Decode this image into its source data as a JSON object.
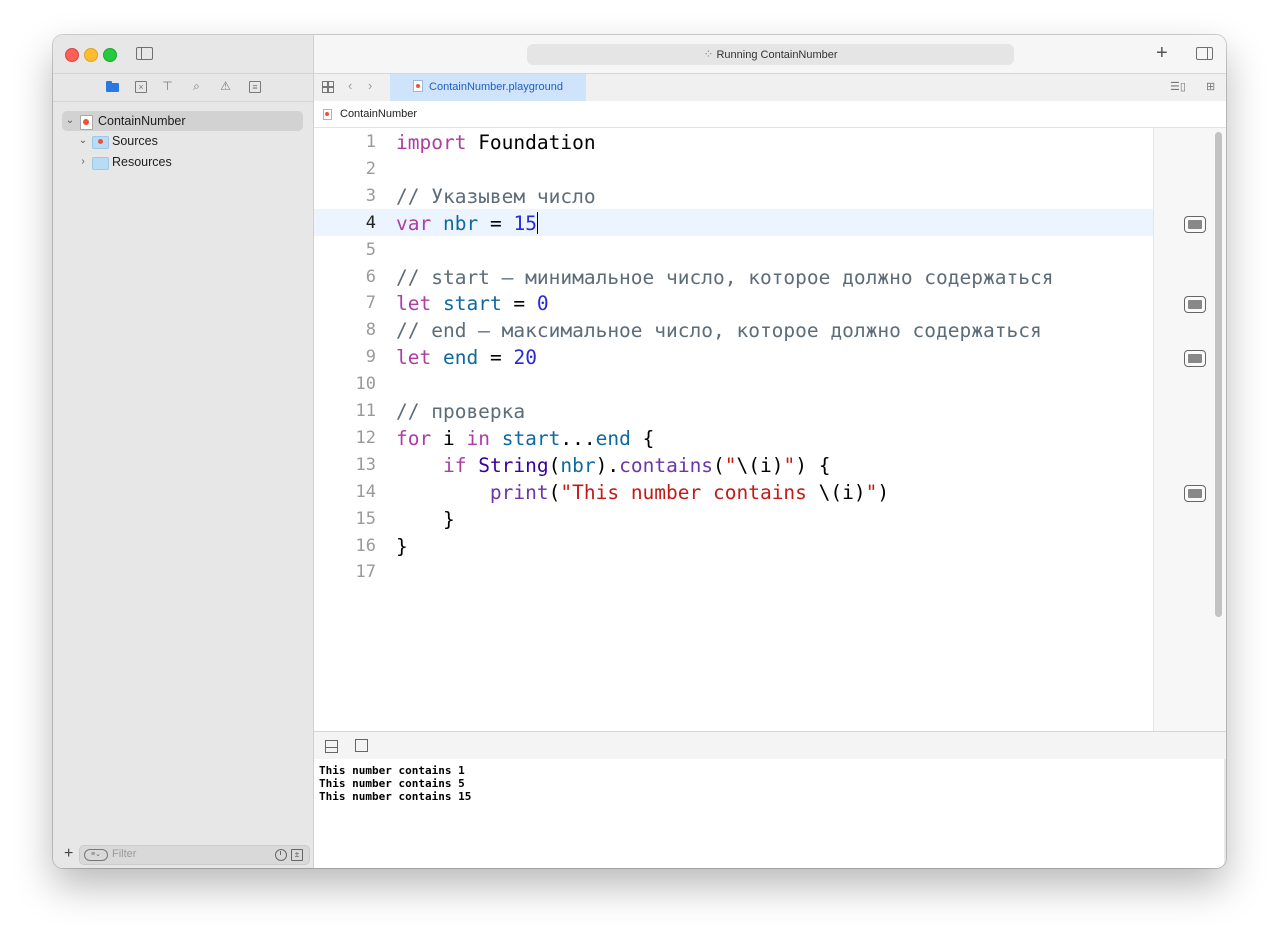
{
  "window": {
    "activity_status": "Running ContainNumber",
    "tab_title": "ContainNumber.playground",
    "jump_bar": "ContainNumber"
  },
  "sidebar": {
    "tree": [
      {
        "label": "ContainNumber",
        "kind": "playground",
        "expanded": true,
        "selected": true
      },
      {
        "label": "Sources",
        "kind": "folder",
        "expanded": true
      },
      {
        "label": "Resources",
        "kind": "folder",
        "expanded": false
      }
    ],
    "filter_placeholder": "Filter"
  },
  "editor": {
    "current_line": 4,
    "line_numbers": [
      "1",
      "2",
      "3",
      "4",
      "5",
      "6",
      "7",
      "8",
      "9",
      "10",
      "11",
      "12",
      "13",
      "14",
      "15",
      "16",
      "17"
    ],
    "lines": [
      [
        {
          "t": "kw",
          "v": "import"
        },
        {
          "t": "pl",
          "v": " Foundation"
        }
      ],
      [],
      [
        {
          "t": "cm",
          "v": "// Указывем число"
        }
      ],
      [
        {
          "t": "kw",
          "v": "var"
        },
        {
          "t": "pl",
          "v": " "
        },
        {
          "t": "vr",
          "v": "nbr"
        },
        {
          "t": "pl",
          "v": " = "
        },
        {
          "t": "nm",
          "v": "15"
        }
      ],
      [],
      [
        {
          "t": "cm",
          "v": "// start – минимальное число, которое должно содержаться"
        }
      ],
      [
        {
          "t": "kw",
          "v": "let"
        },
        {
          "t": "pl",
          "v": " "
        },
        {
          "t": "vr",
          "v": "start"
        },
        {
          "t": "pl",
          "v": " = "
        },
        {
          "t": "nm",
          "v": "0"
        }
      ],
      [
        {
          "t": "cm",
          "v": "// end – максимальное число, которое должно содержаться"
        }
      ],
      [
        {
          "t": "kw",
          "v": "let"
        },
        {
          "t": "pl",
          "v": " "
        },
        {
          "t": "vr",
          "v": "end"
        },
        {
          "t": "pl",
          "v": " = "
        },
        {
          "t": "nm",
          "v": "20"
        }
      ],
      [],
      [
        {
          "t": "cm",
          "v": "// проверка"
        }
      ],
      [
        {
          "t": "kw",
          "v": "for"
        },
        {
          "t": "pl",
          "v": " i "
        },
        {
          "t": "kw",
          "v": "in"
        },
        {
          "t": "pl",
          "v": " "
        },
        {
          "t": "vr",
          "v": "start"
        },
        {
          "t": "pl",
          "v": "..."
        },
        {
          "t": "vr",
          "v": "end"
        },
        {
          "t": "pl",
          "v": " {"
        }
      ],
      [
        {
          "t": "pl",
          "v": "    "
        },
        {
          "t": "kw",
          "v": "if"
        },
        {
          "t": "pl",
          "v": " "
        },
        {
          "t": "ty",
          "v": "String"
        },
        {
          "t": "pl",
          "v": "("
        },
        {
          "t": "vr",
          "v": "nbr"
        },
        {
          "t": "pl",
          "v": ")."
        },
        {
          "t": "fn",
          "v": "contains"
        },
        {
          "t": "pl",
          "v": "("
        },
        {
          "t": "str",
          "v": "\""
        },
        {
          "t": "pl",
          "v": "\\(i)"
        },
        {
          "t": "str",
          "v": "\""
        },
        {
          "t": "pl",
          "v": ") {"
        }
      ],
      [
        {
          "t": "pl",
          "v": "        "
        },
        {
          "t": "fn",
          "v": "print"
        },
        {
          "t": "pl",
          "v": "("
        },
        {
          "t": "str",
          "v": "\"This number contains "
        },
        {
          "t": "pl",
          "v": "\\(i)"
        },
        {
          "t": "str",
          "v": "\""
        },
        {
          "t": "pl",
          "v": ")"
        }
      ],
      [
        {
          "t": "pl",
          "v": "    }"
        }
      ],
      [
        {
          "t": "pl",
          "v": "}"
        }
      ],
      []
    ],
    "result_lines": [
      4,
      7,
      9,
      14
    ]
  },
  "console": {
    "lines": [
      "This number contains 1",
      "This number contains 5",
      "This number contains 15"
    ]
  },
  "colors": {
    "keyword": "#ad3da4",
    "type": "#3900a0",
    "variable": "#0f68a0",
    "function": "#6c36a9",
    "number": "#272ad8",
    "string": "#c41a16",
    "comment": "#5d6c79",
    "accent": "#2a78e4"
  }
}
